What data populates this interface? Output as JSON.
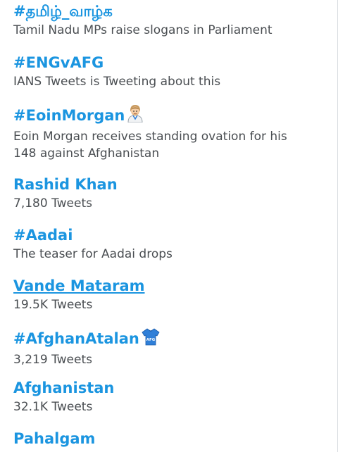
{
  "trends": [
    {
      "name": "#தமிழ்_வாழ்க",
      "context": "Tamil Nadu MPs raise slogans in Parliament"
    },
    {
      "name": "#ENGvAFG",
      "context": "IANS Tweets is Tweeting about this"
    },
    {
      "name": "#EoinMorgan",
      "emoji": "cricketer-emoji",
      "context_line1": "Eoin Morgan receives standing ovation for his",
      "context_line2": "148 against Afghanistan"
    },
    {
      "name": "Rashid Khan",
      "context": "7,180 Tweets"
    },
    {
      "name": "#Aadai",
      "context": "The teaser for Aadai drops"
    },
    {
      "name": "Vande Mataram",
      "context": "19.5K Tweets",
      "hovered": true
    },
    {
      "name": "#AfghanAtalan",
      "emoji": "afg-jersey-emoji",
      "emoji_text": "AFG",
      "context": "3,219 Tweets"
    },
    {
      "name": "Afghanistan",
      "context": "32.1K Tweets"
    },
    {
      "name": "Pahalgam"
    }
  ],
  "colors": {
    "link": "#1b95e0",
    "meta": "#4a4e52",
    "jersey": "#2f7fd8"
  }
}
